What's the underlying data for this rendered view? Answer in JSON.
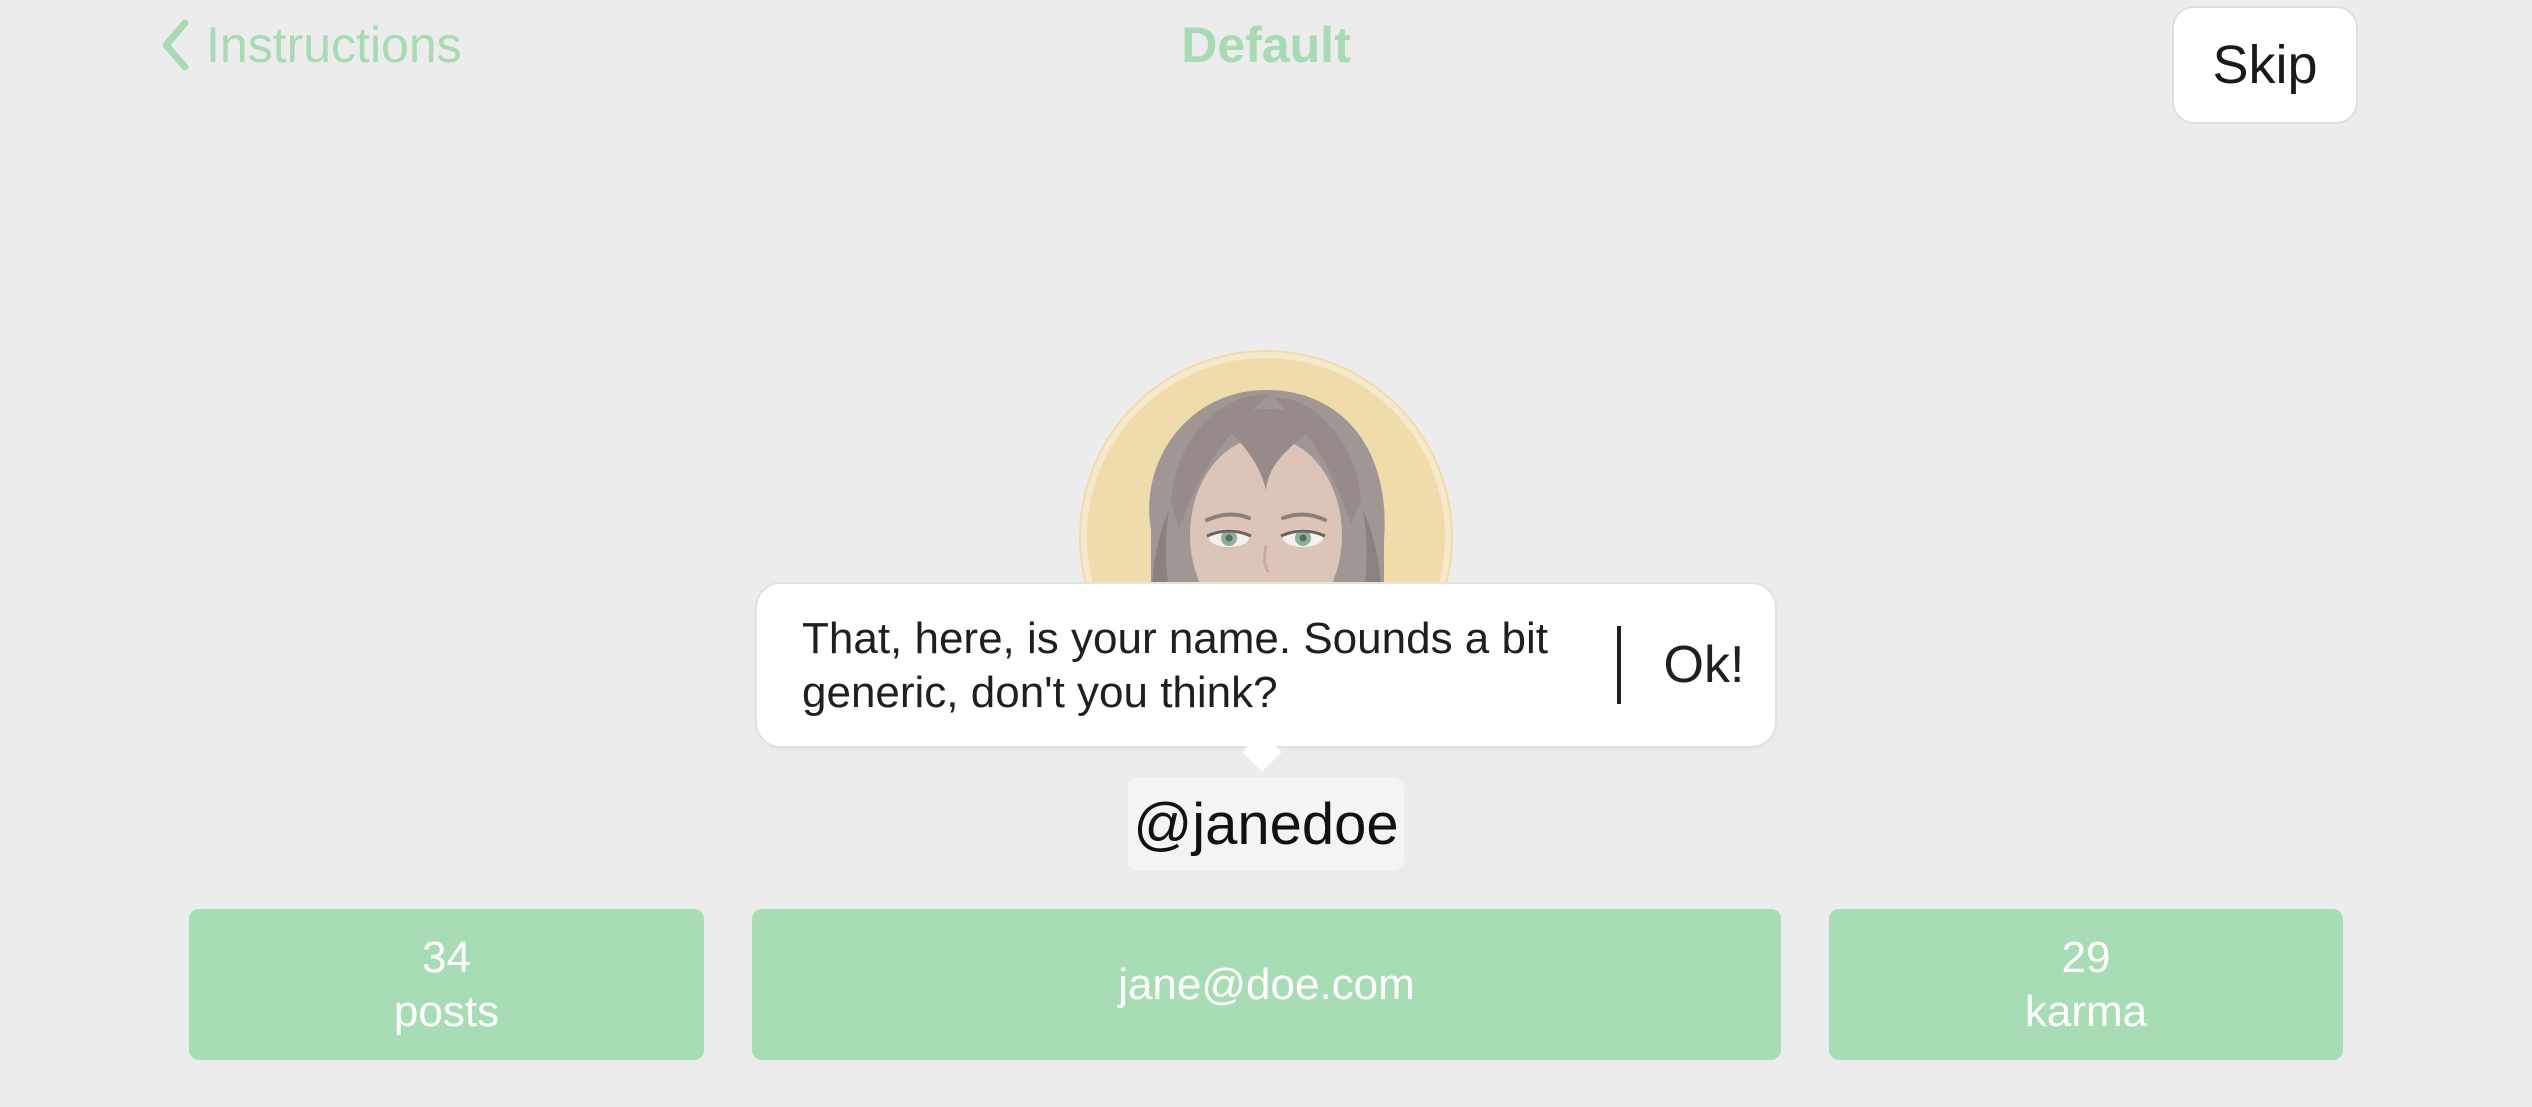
{
  "nav": {
    "back_label": "Instructions",
    "title": "Default",
    "skip_label": "Skip",
    "accent_color": "#a8dab3"
  },
  "tooltip": {
    "message": "That, here, is your name. Sounds a bit generic, don't you think?",
    "ok_label": "Ok!"
  },
  "profile": {
    "username": "@janedoe",
    "avatar_icon": "woman-avatar-icon"
  },
  "stats": {
    "posts": {
      "value": "34",
      "label": "posts"
    },
    "email": {
      "value": "jane@doe.com"
    },
    "karma": {
      "value": "29",
      "label": "karma"
    },
    "tile_color": "#a8dcb4"
  }
}
